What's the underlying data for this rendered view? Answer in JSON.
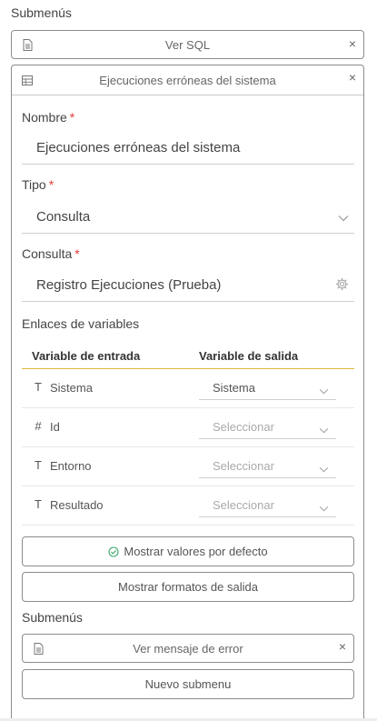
{
  "top": {
    "section_title": "Submenús",
    "submenu_item": {
      "label": "Ver SQL",
      "close": "×"
    }
  },
  "panel": {
    "title": "Ejecuciones erróneas del sistema",
    "close": "×",
    "nombre": {
      "label": "Nombre",
      "required": "*",
      "value": "Ejecuciones erróneas del sistema"
    },
    "tipo": {
      "label": "Tipo",
      "required": "*",
      "value": "Consulta"
    },
    "consulta": {
      "label": "Consulta",
      "required": "*",
      "value": "Registro Ejecuciones (Prueba)"
    },
    "enlaces_title": "Enlaces de variables",
    "vars_header": {
      "input": "Variable de entrada",
      "output": "Variable de salida"
    },
    "variables": [
      {
        "type_icon": "T",
        "name": "Sistema",
        "output": "Sistema",
        "is_placeholder": false
      },
      {
        "type_icon": "#",
        "name": "Id",
        "output": "Seleccionar",
        "is_placeholder": true
      },
      {
        "type_icon": "T",
        "name": "Entorno",
        "output": "Seleccionar",
        "is_placeholder": true
      },
      {
        "type_icon": "T",
        "name": "Resultado",
        "output": "Seleccionar",
        "is_placeholder": true
      }
    ],
    "btn_defaults": "Mostrar valores por defecto",
    "btn_formats": "Mostrar formatos de salida",
    "submenus_title": "Submenús",
    "inner_submenu": {
      "label": "Ver mensaje de error",
      "close": "×"
    },
    "btn_new_submenu": "Nuevo submenu"
  },
  "colors": {
    "required": "#e53935",
    "header_underline": "#e0b63d",
    "check": "#3aa66a"
  }
}
